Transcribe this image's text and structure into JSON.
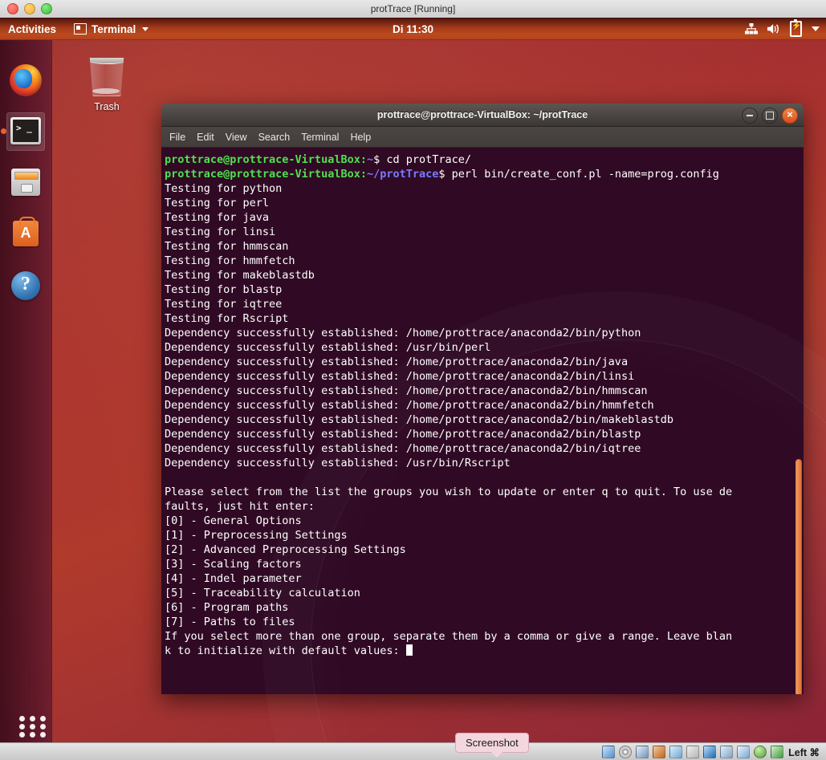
{
  "host_window": {
    "title": "protTrace [Running]",
    "controls": [
      "close",
      "minimize",
      "zoom"
    ]
  },
  "top_panel": {
    "activities": "Activities",
    "app_menu": "Terminal",
    "clock": "Di 11:30",
    "tray_icons": [
      "network-icon",
      "volume-icon",
      "battery-icon",
      "chevron-down-icon"
    ]
  },
  "launcher": {
    "items": [
      {
        "name": "firefox",
        "label": "Firefox Web Browser",
        "active": false
      },
      {
        "name": "terminal",
        "label": "Terminal",
        "active": true
      },
      {
        "name": "files",
        "label": "Files",
        "active": false
      },
      {
        "name": "software",
        "label": "Ubuntu Software",
        "active": false
      },
      {
        "name": "help",
        "label": "Help",
        "active": false
      }
    ],
    "app_grid": "Show Applications"
  },
  "desktop": {
    "icons": [
      {
        "name": "trash",
        "label": "Trash"
      }
    ]
  },
  "terminal": {
    "title": "prottrace@prottrace-VirtualBox: ~/protTrace",
    "menu": [
      "File",
      "Edit",
      "View",
      "Search",
      "Terminal",
      "Help"
    ],
    "window_buttons": [
      "minimize",
      "maximize",
      "close"
    ],
    "colors": {
      "background": "#300a24",
      "foreground": "#ffffff",
      "prompt_user": "#4ee24e",
      "prompt_path": "#7a7aff",
      "scrollbar": "#e06b28"
    },
    "lines": [
      {
        "type": "prompt",
        "user": "prottrace@prottrace-VirtualBox",
        "sep": ":",
        "path": "~",
        "dollar": "$ ",
        "cmd": "cd protTrace/"
      },
      {
        "type": "prompt",
        "user": "prottrace@prottrace-VirtualBox",
        "sep": ":",
        "path": "~/protTrace",
        "dollar": "$ ",
        "cmd": "perl bin/create_conf.pl -name=prog.config"
      },
      {
        "type": "out",
        "text": "Testing for python"
      },
      {
        "type": "out",
        "text": "Testing for perl"
      },
      {
        "type": "out",
        "text": "Testing for java"
      },
      {
        "type": "out",
        "text": "Testing for linsi"
      },
      {
        "type": "out",
        "text": "Testing for hmmscan"
      },
      {
        "type": "out",
        "text": "Testing for hmmfetch"
      },
      {
        "type": "out",
        "text": "Testing for makeblastdb"
      },
      {
        "type": "out",
        "text": "Testing for blastp"
      },
      {
        "type": "out",
        "text": "Testing for iqtree"
      },
      {
        "type": "out",
        "text": "Testing for Rscript"
      },
      {
        "type": "out",
        "text": "Dependency successfully established: /home/prottrace/anaconda2/bin/python"
      },
      {
        "type": "out",
        "text": "Dependency successfully established: /usr/bin/perl"
      },
      {
        "type": "out",
        "text": "Dependency successfully established: /home/prottrace/anaconda2/bin/java"
      },
      {
        "type": "out",
        "text": "Dependency successfully established: /home/prottrace/anaconda2/bin/linsi"
      },
      {
        "type": "out",
        "text": "Dependency successfully established: /home/prottrace/anaconda2/bin/hmmscan"
      },
      {
        "type": "out",
        "text": "Dependency successfully established: /home/prottrace/anaconda2/bin/hmmfetch"
      },
      {
        "type": "out",
        "text": "Dependency successfully established: /home/prottrace/anaconda2/bin/makeblastdb"
      },
      {
        "type": "out",
        "text": "Dependency successfully established: /home/prottrace/anaconda2/bin/blastp"
      },
      {
        "type": "out",
        "text": "Dependency successfully established: /home/prottrace/anaconda2/bin/iqtree"
      },
      {
        "type": "out",
        "text": "Dependency successfully established: /usr/bin/Rscript"
      },
      {
        "type": "out",
        "text": ""
      },
      {
        "type": "out",
        "text": "Please select from the list the groups you wish to update or enter q to quit. To use de"
      },
      {
        "type": "out",
        "text": "faults, just hit enter:"
      },
      {
        "type": "out",
        "text": "[0] - General Options"
      },
      {
        "type": "out",
        "text": "[1] - Preprocessing Settings"
      },
      {
        "type": "out",
        "text": "[2] - Advanced Preprocessing Settings"
      },
      {
        "type": "out",
        "text": "[3] - Scaling factors"
      },
      {
        "type": "out",
        "text": "[4] - Indel parameter"
      },
      {
        "type": "out",
        "text": "[5] - Traceability calculation"
      },
      {
        "type": "out",
        "text": "[6] - Program paths"
      },
      {
        "type": "out",
        "text": "[7] - Paths to files"
      },
      {
        "type": "out",
        "text": "If you select more than one group, separate them by a comma or give a range. Leave blan"
      },
      {
        "type": "cursor",
        "text": "k to initialize with default values: "
      }
    ]
  },
  "tooltip": {
    "text": "Screenshot"
  },
  "status_bar": {
    "host_key": "Left ⌘",
    "icons": [
      "hard-disk-icon",
      "optical-disk-icon",
      "floppy-icon",
      "network-icon",
      "usb-icon",
      "shared-folder-icon",
      "display-icon",
      "recording-icon",
      "usb-device-icon",
      "mouse-icon",
      "keyboard-icon"
    ]
  }
}
